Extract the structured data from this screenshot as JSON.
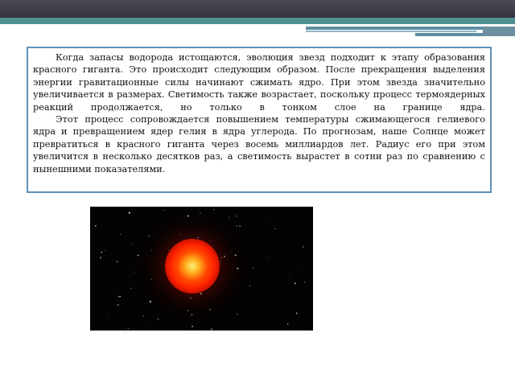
{
  "paragraphs": [
    "Когда запасы водорода истощаются, эволюция звезд подходит к этапу образования красного гиганта. Это происходит следующим образом. После прекращения выделения энергии гравитационные силы начинают сжимать ядро. При этом звезда значительно увеличивается в размерах. Светимость также возрастает, поскольку процесс термоядерных реакций продолжается, но только в тонком слое на границе ядра.",
    "Этот процесс сопровождается повышением температуры сжимающегося гелиевого ядра и превращением ядер гелия в ядра углерода. По прогнозам, наше Солнце может превратиться в красного гиганта через восемь миллиардов лет. Радиус его при этом увеличится в несколько десятков раз, а светимость вырастет в сотни раз по сравнению с нынешними показателями."
  ],
  "colors": {
    "header_dark": "#3d3e46",
    "teal": "#4f8f92",
    "accent_blue": "#5d8fa4",
    "box_border": "#5f90b6",
    "star_core": "#ffe14a",
    "star_red": "#ff2200"
  },
  "image": {
    "subject": "red-giant-star"
  }
}
